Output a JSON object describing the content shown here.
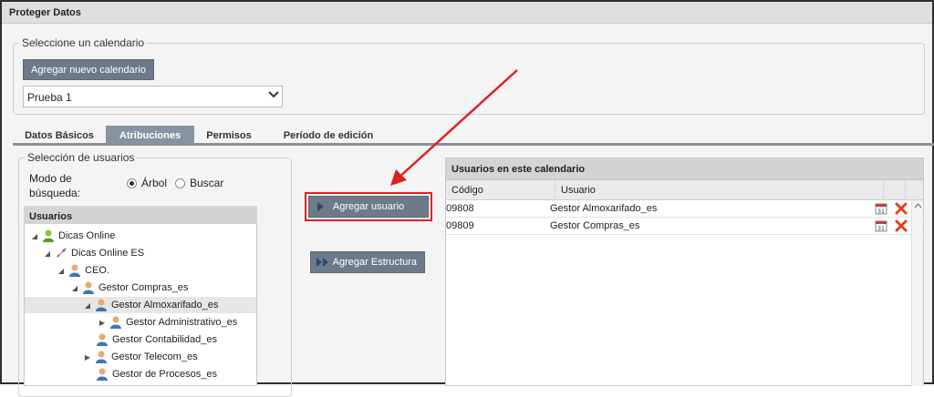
{
  "window": {
    "title": "Proteger Datos"
  },
  "calendar_section": {
    "legend": "Seleccione un calendario",
    "add_button": "Agregar nuevo calendario",
    "selected_calendar": "Prueba 1"
  },
  "tabs": [
    {
      "label": "Datos Básicos",
      "active": false
    },
    {
      "label": "Atribuciones",
      "active": true
    },
    {
      "label": "Permisos",
      "active": false
    },
    {
      "label": "Período de edición",
      "active": false
    }
  ],
  "user_selection": {
    "legend": "Selección de usuarios",
    "search_mode_label": "Modo de búsqueda:",
    "search_mode_line1": "Modo de",
    "search_mode_line2": "búsqueda:",
    "option_tree": "Árbol",
    "option_search": "Buscar",
    "selected_option": "Árbol",
    "tree_header": "Usuarios",
    "tree": [
      {
        "label": "Dicas Online",
        "icon": "group-icon",
        "expanded": true,
        "level": 0
      },
      {
        "label": "Dicas Online ES",
        "icon": "rocket-icon",
        "expanded": true,
        "level": 1
      },
      {
        "label": "CEO.",
        "icon": "user-icon",
        "expanded": true,
        "level": 2
      },
      {
        "label": "Gestor Compras_es",
        "icon": "user-icon",
        "expanded": true,
        "level": 3
      },
      {
        "label": "Gestor Almoxarifado_es",
        "icon": "user-icon",
        "expanded": true,
        "level": 4,
        "selected": true
      },
      {
        "label": "Gestor Administrativo_es",
        "icon": "user-icon",
        "expanded": false,
        "level": 5
      },
      {
        "label": "Gestor Contabilidad_es",
        "icon": "user-icon",
        "expanded": null,
        "level": 4
      },
      {
        "label": "Gestor Telecom_es",
        "icon": "user-icon",
        "expanded": false,
        "level": 4
      },
      {
        "label": "Gestor de Procesos_es",
        "icon": "user-icon",
        "expanded": null,
        "level": 4
      }
    ]
  },
  "actions": {
    "add_user": "Agregar usuario",
    "add_structure": "Agregar Estructura"
  },
  "calendar_users": {
    "header": "Usuarios en este calendario",
    "columns": [
      "Código",
      "Usuario"
    ],
    "rows": [
      {
        "code": "09808",
        "user": "Gestor Almoxarifado_es"
      },
      {
        "code": "09809",
        "user": "Gestor Compras_es"
      }
    ],
    "row_actions": [
      "calendar-icon",
      "delete-icon"
    ]
  },
  "colors": {
    "button": "#6c7a89",
    "tab_active": "#8893a1",
    "highlight": "#e02020",
    "delete": "#e04020"
  }
}
